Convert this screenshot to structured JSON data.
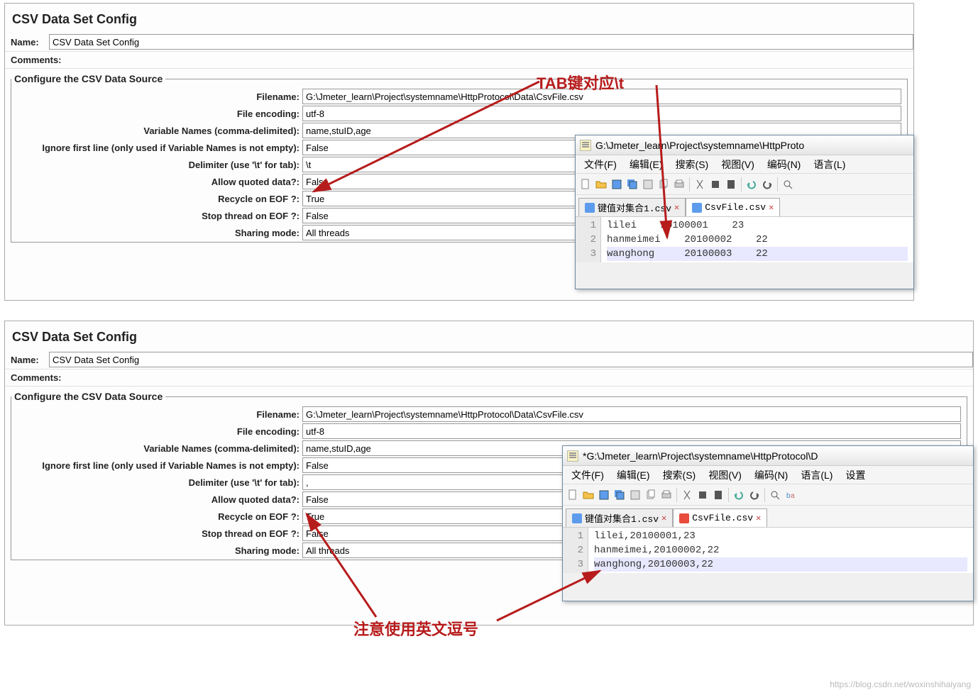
{
  "panel1": {
    "title": "CSV Data Set Config",
    "name_label": "Name:",
    "name_value": "CSV Data Set Config",
    "comments_label": "Comments:",
    "fieldset_legend": "Configure the CSV Data Source",
    "filename_label": "Filename:",
    "filename_value": "G:\\Jmeter_learn\\Project\\systemname\\HttpProtocol\\Data\\CsvFile.csv",
    "encoding_label": "File encoding:",
    "encoding_value": "utf-8",
    "varnames_label": "Variable Names (comma-delimited):",
    "varnames_value": "name,stuID,age",
    "ignorefirst_label": "Ignore first line (only used if Variable Names is not empty):",
    "ignorefirst_value": "False",
    "delimiter_label": "Delimiter (use '\\t' for tab):",
    "delimiter_value": "\\t",
    "allowquoted_label": "Allow quoted data?:",
    "allowquoted_value": "False",
    "recycle_label": "Recycle on EOF ?:",
    "recycle_value": "True",
    "stopthread_label": "Stop thread on EOF ?:",
    "stopthread_value": "False",
    "sharing_label": "Sharing mode:",
    "sharing_value": "All threads"
  },
  "panel2": {
    "title": "CSV Data Set Config",
    "name_label": "Name:",
    "name_value": "CSV Data Set Config",
    "comments_label": "Comments:",
    "fieldset_legend": "Configure the CSV Data Source",
    "filename_label": "Filename:",
    "filename_value": "G:\\Jmeter_learn\\Project\\systemname\\HttpProtocol\\Data\\CsvFile.csv",
    "encoding_label": "File encoding:",
    "encoding_value": "utf-8",
    "varnames_label": "Variable Names (comma-delimited):",
    "varnames_value": "name,stuID,age",
    "ignorefirst_label": "Ignore first line (only used if Variable Names is not empty):",
    "ignorefirst_value": "False",
    "delimiter_label": "Delimiter (use '\\t' for tab):",
    "delimiter_value": ",",
    "allowquoted_label": "Allow quoted data?:",
    "allowquoted_value": "False",
    "recycle_label": "Recycle on EOF ?:",
    "recycle_value": "True",
    "stopthread_label": "Stop thread on EOF ?:",
    "stopthread_value": "False",
    "sharing_label": "Sharing mode:",
    "sharing_value": "All threads"
  },
  "editor1": {
    "title": "G:\\Jmeter_learn\\Project\\systemname\\HttpProto",
    "menu_file": "文件(F)",
    "menu_edit": "编辑(E)",
    "menu_search": "搜索(S)",
    "menu_view": "视图(V)",
    "menu_encoding": "编码(N)",
    "menu_lang": "语言(L)",
    "tab1": "键值对集合1.csv",
    "tab2": "CsvFile.csv",
    "lines": [
      "1",
      "2",
      "3"
    ],
    "code_l1": "lilei    20100001    23",
    "code_l2": "hanmeimei    20100002    22",
    "code_l3": "wanghong     20100003    22"
  },
  "editor2": {
    "title": "*G:\\Jmeter_learn\\Project\\systemname\\HttpProtocol\\D",
    "menu_file": "文件(F)",
    "menu_edit": "编辑(E)",
    "menu_search": "搜索(S)",
    "menu_view": "视图(V)",
    "menu_encoding": "编码(N)",
    "menu_lang": "语言(L)",
    "menu_settings": "设置",
    "tab1": "键值对集合1.csv",
    "tab2": "CsvFile.csv",
    "lines": [
      "1",
      "2",
      "3"
    ],
    "code_l1": "lilei,20100001,23",
    "code_l2": "hanmeimei,20100002,22",
    "code_l3": "wanghong,20100003,22"
  },
  "annotations": {
    "tab_note": "TAB键对应\\t",
    "comma_note": "注意使用英文逗号"
  },
  "watermark": "https://blog.csdn.net/woxinshihaiyang"
}
